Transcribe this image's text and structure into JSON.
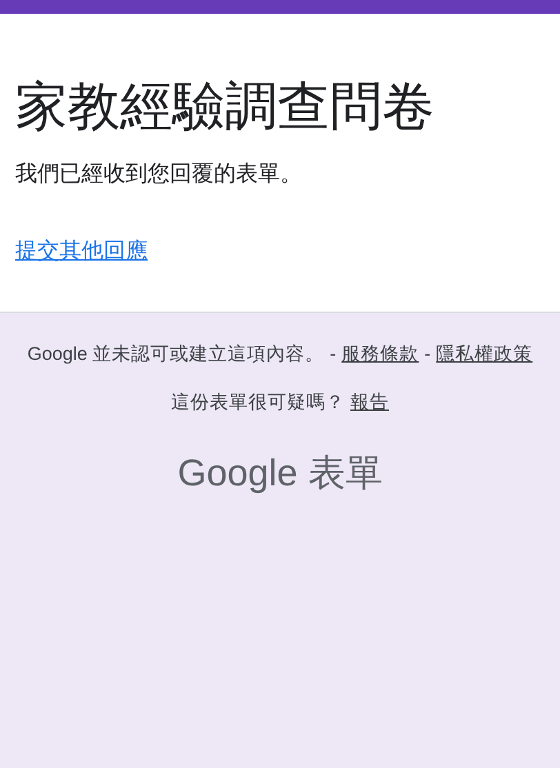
{
  "form": {
    "title": "家教經驗調查問卷",
    "message": "我們已經收到您回覆的表單。",
    "link": "提交其他回應"
  },
  "footer": {
    "disclaimer": "Google 並未認可或建立這項內容。",
    "separator_1": "-",
    "terms_link": "服務條款",
    "separator_2": "-",
    "privacy_link": "隱私權政策",
    "question": "這份表單很可疑嗎？",
    "report_link": "報告",
    "logo": "Google 表單"
  }
}
